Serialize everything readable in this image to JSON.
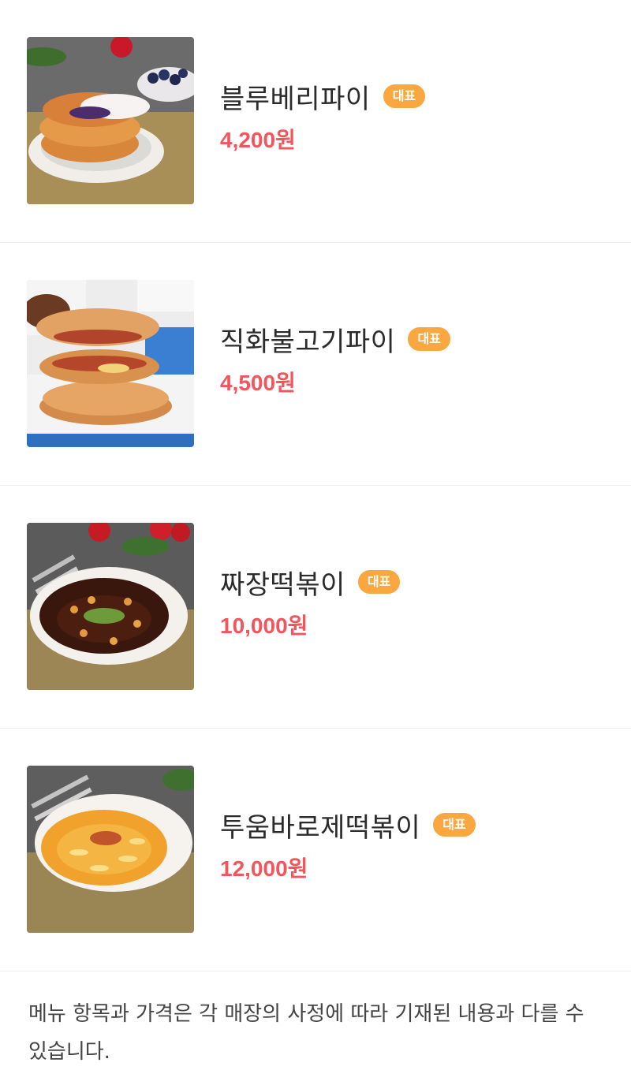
{
  "menu": {
    "items": [
      {
        "name": "블루베리파이",
        "badge": "대표",
        "price": "4,200원",
        "image": "blueberry-pie-photo"
      },
      {
        "name": "직화불고기파이",
        "badge": "대표",
        "price": "4,500원",
        "image": "bulgogi-pie-photo"
      },
      {
        "name": "짜장떡볶이",
        "badge": "대표",
        "price": "10,000원",
        "image": "jjajang-tteokbokki-photo"
      },
      {
        "name": "투움바로제떡볶이",
        "badge": "대표",
        "price": "12,000원",
        "image": "toowoomba-rose-tteokbokki-photo"
      }
    ]
  },
  "notice": "메뉴 항목과 가격은 각 매장의 사정에 따라 기재된 내용과 다를 수 있습니다.",
  "colors": {
    "badge": "#f9a73e",
    "price": "#f2555c",
    "divider": "#ececec"
  }
}
